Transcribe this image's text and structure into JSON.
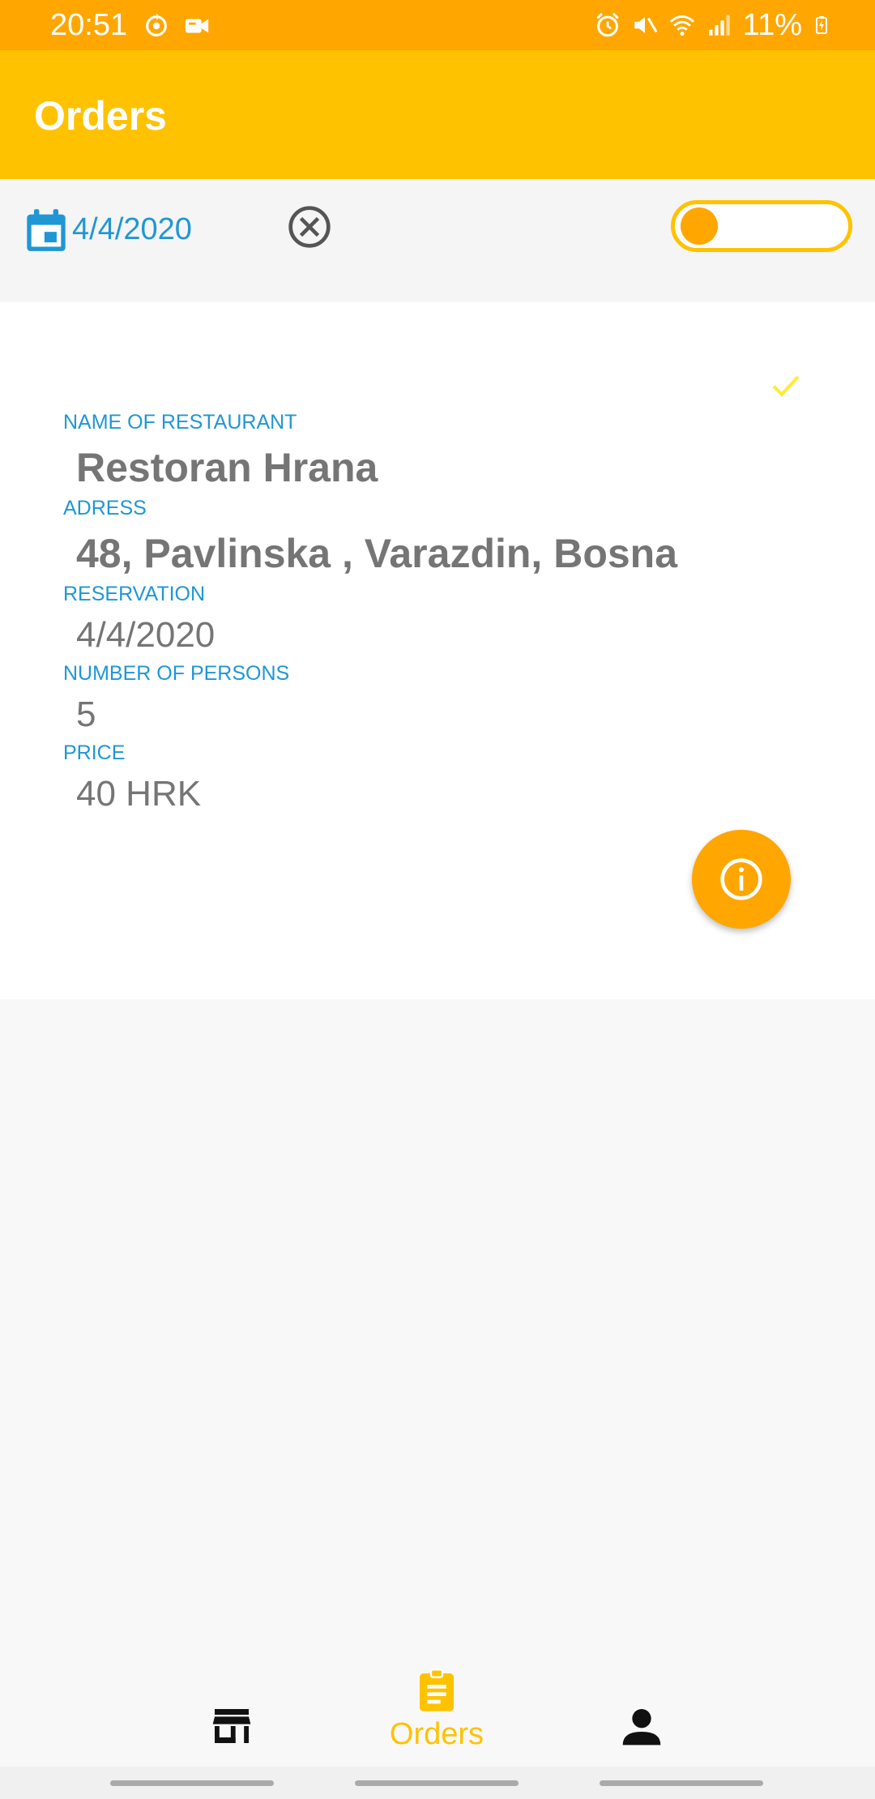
{
  "status_bar": {
    "time": "20:51",
    "battery": "11%",
    "left_icons": [
      "sync-icon",
      "video-call-icon"
    ],
    "right_icons": [
      "alarm-icon",
      "mute-icon",
      "wifi-icon",
      "signal-icon",
      "battery-charging-icon"
    ]
  },
  "app_bar": {
    "title": "Orders"
  },
  "filter": {
    "date": "4/4/2020",
    "icons": [
      "calendar-icon",
      "clear-icon"
    ],
    "toggle_on": false
  },
  "order": {
    "status_icon": "check-icon",
    "fields": [
      {
        "label": "NAME OF RESTAURANT",
        "value": "Restoran Hrana"
      },
      {
        "label": "ADRESS",
        "value": "48, Pavlinska , Varazdin, Bosna"
      },
      {
        "label": "RESERVATION",
        "value": "4/4/2020"
      },
      {
        "label": "NUMBER OF PERSONS",
        "value": "5"
      },
      {
        "label": "PRICE",
        "value": "40 HRK"
      }
    ],
    "action_icon": "info-icon"
  },
  "bottom_nav": {
    "items": [
      {
        "icon": "store-icon",
        "label": ""
      },
      {
        "icon": "orders-icon",
        "label": "Orders",
        "active": true
      },
      {
        "icon": "person-icon",
        "label": ""
      }
    ]
  },
  "colors": {
    "status_bar": "#ffa600",
    "app_bar": "#ffc200",
    "accent": "#ffa600",
    "label_blue": "#1f97d4",
    "value_gray": "#757575"
  }
}
